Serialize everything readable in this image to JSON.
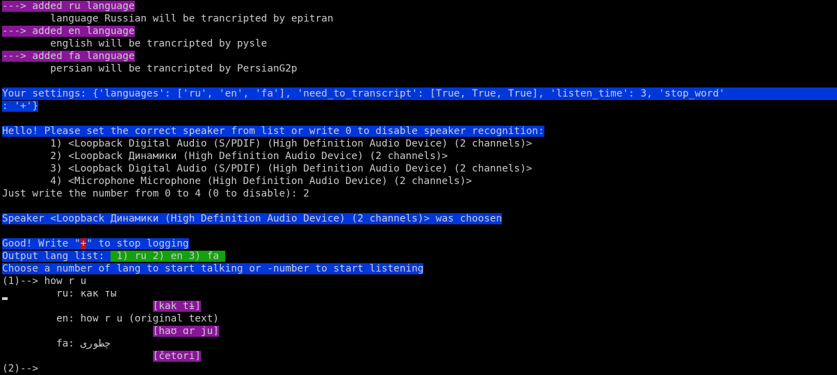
{
  "terminal": {
    "lines": [
      {
        "type": "magenta",
        "text": "---> added ru language"
      },
      {
        "type": "plain",
        "text": "        language Russian will be trancripted by epitran"
      },
      {
        "type": "magenta",
        "text": "---> added en language"
      },
      {
        "type": "plain",
        "text": "        english will be trancripted by pysle"
      },
      {
        "type": "magenta",
        "text": "---> added fa language"
      },
      {
        "type": "plain",
        "text": "        persian will be trancripted by PersianG2p"
      },
      {
        "type": "blank",
        "text": ""
      },
      {
        "type": "fullblue",
        "text": "Your settings: {'languages': ['ru', 'en', 'fa'], 'need_to_transcript': [True, True, True], 'listen_time': 3, 'stop_word'"
      },
      {
        "type": "blue",
        "text": ": '+'}"
      },
      {
        "type": "blank",
        "text": ""
      },
      {
        "type": "blue",
        "text": "Hello! Please set the correct speaker from list or write 0 to disable speaker recognition:"
      },
      {
        "type": "plain",
        "text": "        1) <Loopback Digital Audio (S/PDIF) (High Definition Audio Device) (2 channels)>"
      },
      {
        "type": "plain",
        "text": "        2) <Loopback Динамики (High Definition Audio Device) (2 channels)>"
      },
      {
        "type": "plain",
        "text": "        3) <Loopback Digital Audio (S/PDIF) (High Definition Audio Device) (2 channels)>"
      },
      {
        "type": "plain",
        "text": "        4) <Microphone Microphone (High Definition Audio Device) (2 channels)>"
      },
      {
        "type": "plain",
        "text": "Just write the number from 0 to 4 (0 to disable): 2"
      },
      {
        "type": "blank",
        "text": ""
      },
      {
        "type": "blue",
        "text": "Speaker <Loopback Динамики (High Definition Audio Device) (2 channels)> was choosen"
      },
      {
        "type": "blank",
        "text": ""
      },
      {
        "type": "stopword"
      },
      {
        "type": "outputlang"
      },
      {
        "type": "blue",
        "text": "Choose a number of lang to start talking or -number to start listening"
      },
      {
        "type": "plain",
        "text": "(1)--> how r u"
      },
      {
        "type": "plain",
        "text": "         ru: как ты"
      },
      {
        "type": "indentmagenta",
        "indent": "                         ",
        "text": "[kak tɨ]"
      },
      {
        "type": "plain",
        "text": "         en: how r u (original text)"
      },
      {
        "type": "indentmagenta",
        "indent": "                         ",
        "text": "[haʊ ɑr ju]"
      },
      {
        "type": "plain",
        "text": "         fa: چطوری"
      },
      {
        "type": "indentmagenta",
        "indent": "                         ",
        "text": "[četori]"
      },
      {
        "type": "plain",
        "text": "(2)-->"
      }
    ],
    "stop_word_prefix": "Good! Write \"",
    "stop_word": "+",
    "stop_word_suffix": "\" to stop logging",
    "output_lang_prefix": "Output lang list: ",
    "output_lang_list": " 1) ru 2) en 3) fa ",
    "colors": {
      "background": "#000000",
      "foreground": "#cccccc",
      "magenta": "#881798",
      "blue": "#0037da",
      "green": "#13a10e",
      "red": "#c50f1f"
    }
  }
}
